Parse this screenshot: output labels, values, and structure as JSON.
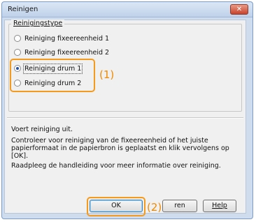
{
  "window": {
    "title": "Reinigen",
    "close_label": "✕"
  },
  "group": {
    "legend": "Reinigingstype",
    "options": [
      {
        "label": "Reiniging fixeereenheid 1",
        "checked": false
      },
      {
        "label": "Reiniging fixeereenheid 2",
        "checked": false
      },
      {
        "label": "Reiniging drum 1",
        "checked": true
      },
      {
        "label": "Reiniging drum 2",
        "checked": false
      }
    ]
  },
  "callouts": {
    "first": "(1)",
    "second": "(2)"
  },
  "description": {
    "line1": "Voert reiniging uit.",
    "line2": "Controleer voor reiniging van de fixeereenheid of het juiste papierformaat in de papierbron is geplaatst en klik vervolgens op [OK].",
    "line3": "Raadpleeg de handleiding voor meer informatie over reiniging."
  },
  "buttons": {
    "ok": "OK",
    "cancel": "ren",
    "help": "Help"
  },
  "colors": {
    "highlight": "#f59a1b",
    "callout_text": "#f08a00"
  }
}
